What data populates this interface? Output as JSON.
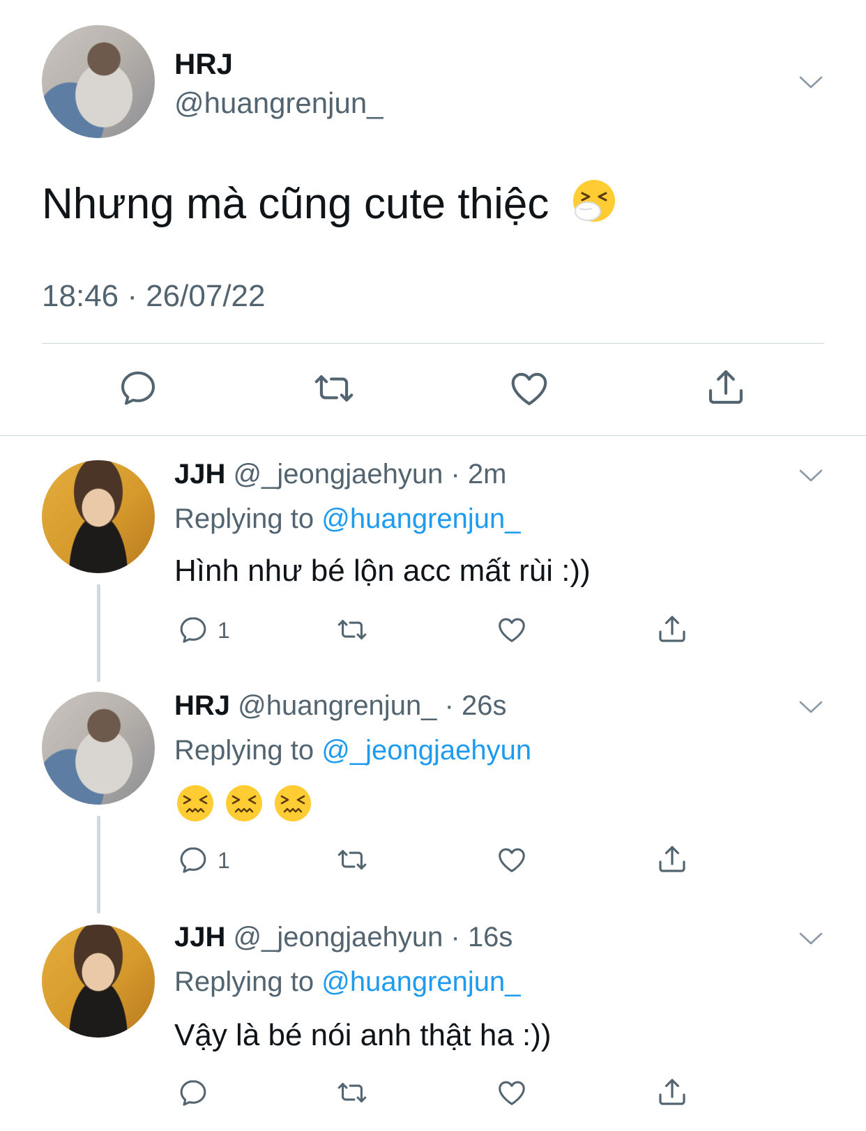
{
  "main_tweet": {
    "display_name": "HRJ",
    "handle": "@huangrenjun_",
    "text": "Nhưng mà cũng cute thiệc",
    "text_emoji": "sneezing-face-emoji",
    "timestamp": "18:46 · 26/07/22"
  },
  "replies": [
    {
      "display_name": "JJH",
      "handle": "@_jeongjaehyun",
      "separator": "·",
      "age": "2m",
      "replying_label": "Replying to ",
      "replying_to": "@huangrenjun_",
      "text": "Hình như bé lộn acc mất rùi :))",
      "reply_count": "1"
    },
    {
      "display_name": "HRJ",
      "handle": "@huangrenjun_",
      "separator": "·",
      "age": "26s",
      "replying_label": "Replying to ",
      "replying_to": "@_jeongjaehyun",
      "text": "",
      "text_emojis": [
        "confounded-face-emoji",
        "confounded-face-emoji",
        "confounded-face-emoji"
      ],
      "reply_count": "1"
    },
    {
      "display_name": "JJH",
      "handle": "@_jeongjaehyun",
      "separator": "·",
      "age": "16s",
      "replying_label": "Replying to ",
      "replying_to": "@huangrenjun_",
      "text": "Vậy là bé nói anh thật ha :))",
      "reply_count": ""
    }
  ],
  "colors": {
    "primary_text": "#0f1419",
    "secondary_text": "#536471",
    "mention": "#1d9bf0",
    "divider": "#cfd9de"
  },
  "icons": [
    "chevron-down-icon",
    "reply-icon",
    "retweet-icon",
    "like-icon",
    "share-icon"
  ]
}
